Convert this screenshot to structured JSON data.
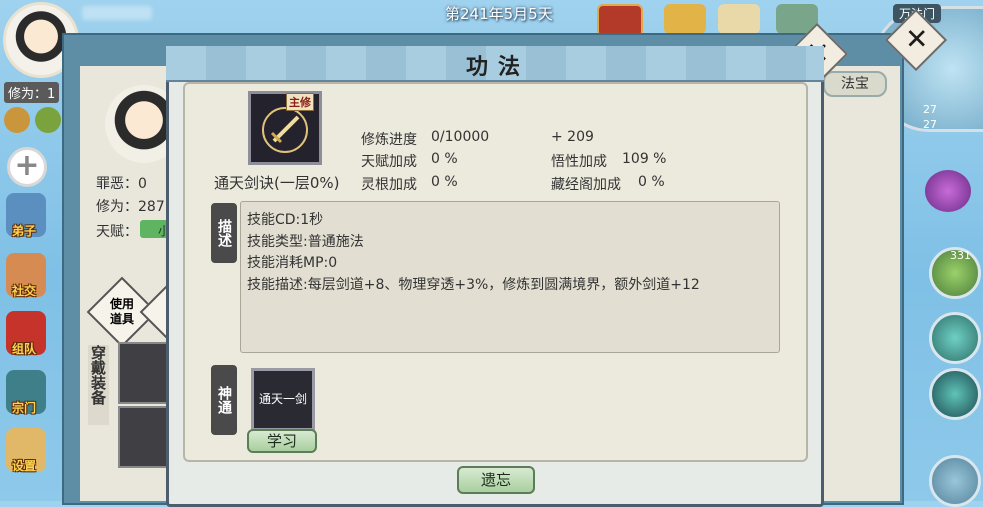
{
  "top": {
    "date": "第241年5月5天"
  },
  "player": {
    "xiuwei_tag": "修为：1"
  },
  "left_nav": [
    {
      "label": "弟子"
    },
    {
      "label": "社交"
    },
    {
      "label": "组队"
    },
    {
      "label": "宗门"
    },
    {
      "label": "设置"
    }
  ],
  "minimap": {
    "sect_name": "万法门",
    "num1": "27",
    "num2": "27"
  },
  "right_items": {
    "badge": "331"
  },
  "back_panel": {
    "zui_e_label": "罪恶：",
    "zui_e_value": "0",
    "xiuwei_label": "修为：",
    "xiuwei_value": "287",
    "tianfu_label": "天赋：",
    "tianfu_value": "小",
    "fabao_tab": "法宝",
    "use_item": "使用道具",
    "wear_equip": "穿戴装备"
  },
  "dialog": {
    "title": "功法",
    "skill": {
      "name": "通天剑诀(一层0%)",
      "tag": "主修",
      "icon": "sword-icon"
    },
    "stats": {
      "progress_label": "修炼进度",
      "progress_value": "0/10000",
      "progress_bonus": "+ 209",
      "tianfu_label": "天赋加成",
      "tianfu_value": "0 %",
      "wuxing_label": "悟性加成",
      "wuxing_value": "109 %",
      "linggen_label": "灵根加成",
      "linggen_value": "0 %",
      "cangjing_label": "藏经阁加成",
      "cangjing_value": "0 %"
    },
    "desc_tag": "描述",
    "desc_lines": [
      "技能CD:1秒",
      "技能类型:普通施法",
      "技能消耗MP:0",
      "技能描述:每层剑道+8、物理穿透+3%，修炼到圆满境界，额外剑道+12"
    ],
    "shentong_tag": "神通",
    "shentong_slot": "通天一剑",
    "learn_button": "学习",
    "forget_button": "遗忘"
  },
  "colors": {
    "accent_green": "#a9cf9f",
    "panel_blue": "#5e8da6"
  }
}
